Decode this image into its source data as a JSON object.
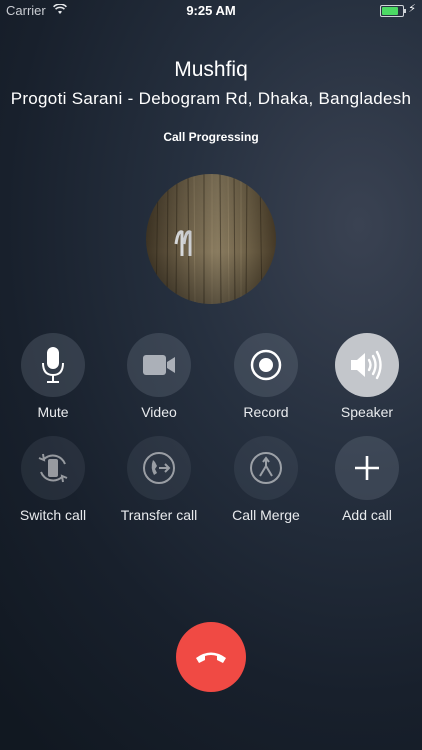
{
  "status_bar": {
    "carrier": "Carrier",
    "time": "9:25 AM",
    "battery_level": 0.8
  },
  "caller": {
    "name": "Mushfiq",
    "location": "Progoti Sarani - Debogram Rd, Dhaka, Bangladesh",
    "status": "Call Progressing"
  },
  "controls": {
    "mute": {
      "label": "Mute",
      "icon": "microphone-icon"
    },
    "video": {
      "label": "Video",
      "icon": "video-camera-icon"
    },
    "record": {
      "label": "Record",
      "icon": "record-icon"
    },
    "speaker": {
      "label": "Speaker",
      "icon": "speaker-icon",
      "active": true
    },
    "switch_call": {
      "label": "Switch call",
      "icon": "switch-call-icon"
    },
    "transfer_call": {
      "label": "Transfer call",
      "icon": "transfer-call-icon"
    },
    "call_merge": {
      "label": "Call Merge",
      "icon": "merge-icon"
    },
    "add_call": {
      "label": "Add call",
      "icon": "plus-icon"
    }
  },
  "end_call": {
    "icon": "end-call-icon",
    "color": "#f04a44"
  },
  "colors": {
    "accent_active": "#c3c6cb",
    "battery": "#4cd964"
  }
}
